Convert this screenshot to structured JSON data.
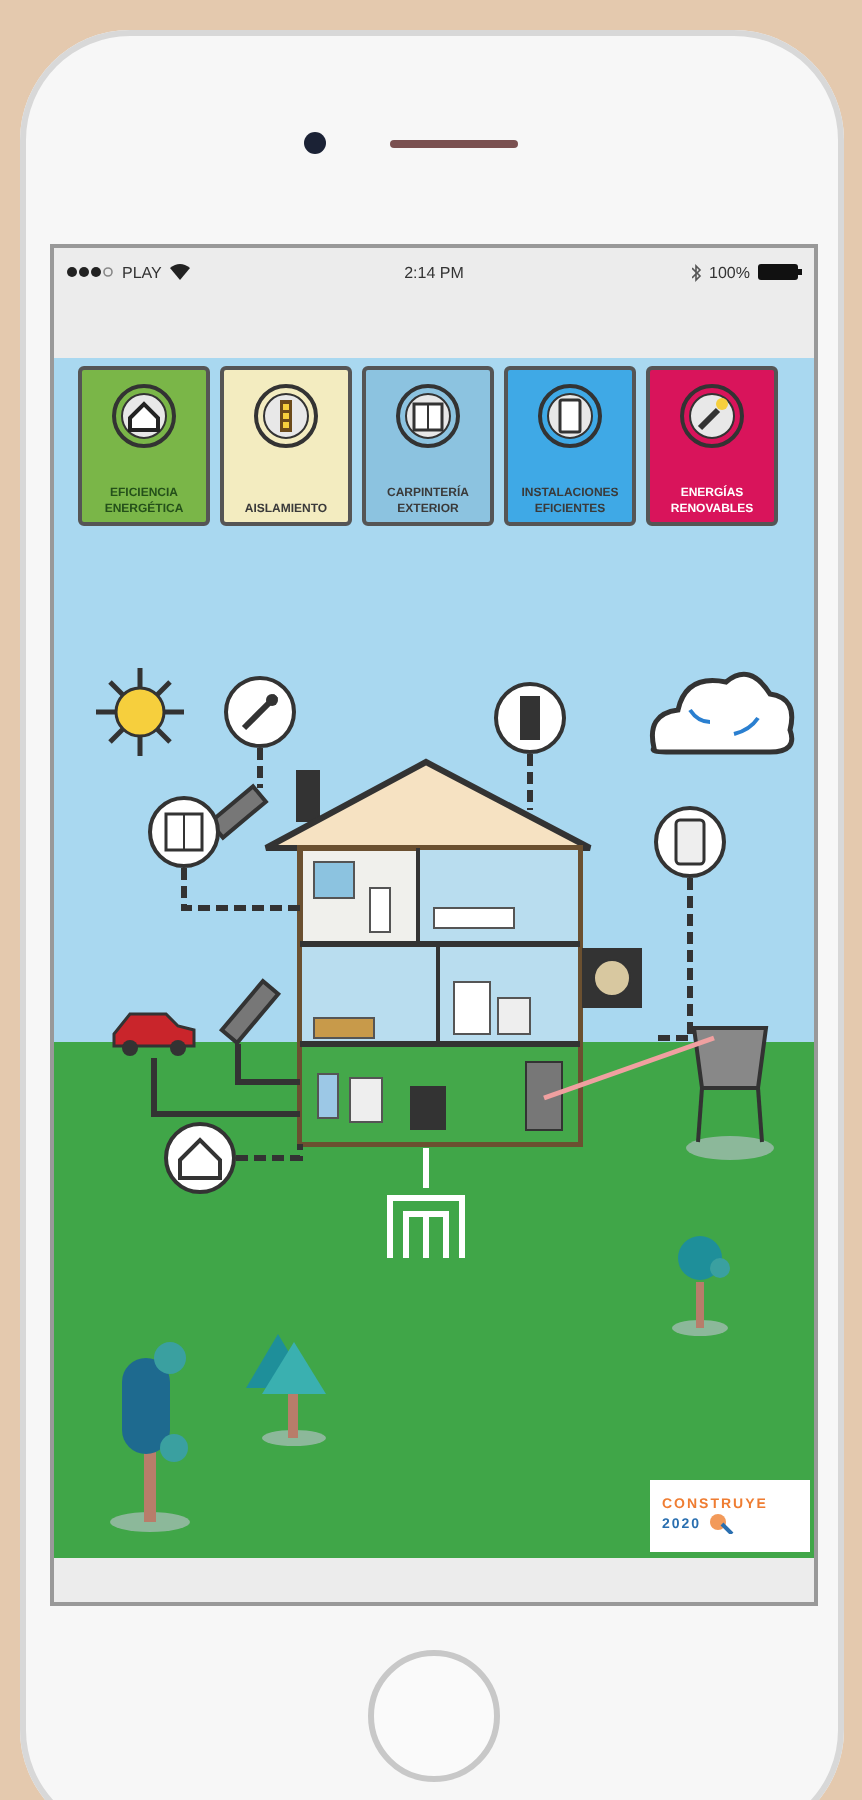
{
  "status_bar": {
    "carrier": "PLAY",
    "time": "2:14 PM",
    "battery": "100%"
  },
  "categories": [
    {
      "label": "EFICIENCIA ENERGÉTICA",
      "color": "#7ab648"
    },
    {
      "label": "AISLAMIENTO",
      "color": "#f3ecc0"
    },
    {
      "label": "CARPINTERÍA EXTERIOR",
      "color": "#8cc3e0"
    },
    {
      "label": "INSTALACIONES EFICIENTES",
      "color": "#3fa9e6"
    },
    {
      "label": "ENERGÍAS RENOVABLES",
      "color": "#d9145b"
    }
  ],
  "logo": {
    "line_1": "CONSTRUYE",
    "line_2": "2020"
  }
}
